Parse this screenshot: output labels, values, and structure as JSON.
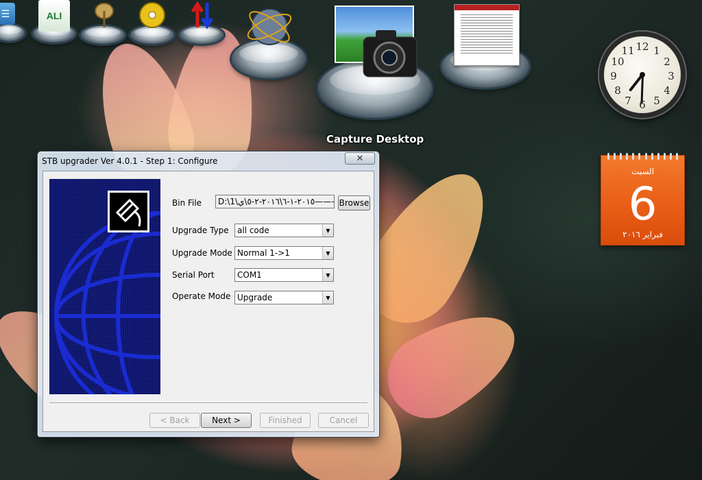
{
  "desktop": {
    "capture_label": "Capture Desktop",
    "icons": [
      "app-icon",
      "ali-icon",
      "satellite-dish-icon",
      "cd-icon",
      "transfer-arrows-icon",
      "globe-icon",
      "camera-icon",
      "webpage-icon"
    ]
  },
  "clock": {
    "numbers": [
      "12",
      "1",
      "2",
      "3",
      "4",
      "5",
      "6",
      "7",
      "8",
      "9",
      "10",
      "11"
    ]
  },
  "calendar": {
    "weekday": "السبت",
    "day": "6",
    "month_year": "فبراير ٢٠١٦"
  },
  "window": {
    "title": "STB upgrader Ver 4.0.1 - Step 1: Configure",
    "close_glyph": "✕",
    "bin_file": {
      "label": "Bin File",
      "value": "D:\\1\\٢٠١٥-١-٦\\٢٠١٦-٢-٥\\ي———",
      "browse": "Browse"
    },
    "upgrade_type": {
      "label": "Upgrade Type",
      "value": "all code"
    },
    "upgrade_mode": {
      "label": "Upgrade Mode",
      "value": "Normal 1->1"
    },
    "serial_port": {
      "label": "Serial Port",
      "value": "COM1"
    },
    "operate_mode": {
      "label": "Operate Mode",
      "value": "Upgrade"
    },
    "buttons": {
      "back": "< Back",
      "next": "Next >",
      "finished": "Finished",
      "cancel": "Cancel"
    }
  },
  "colors": {
    "panel_blue": "#0b1363",
    "calendar_orange": "#e85c16"
  }
}
